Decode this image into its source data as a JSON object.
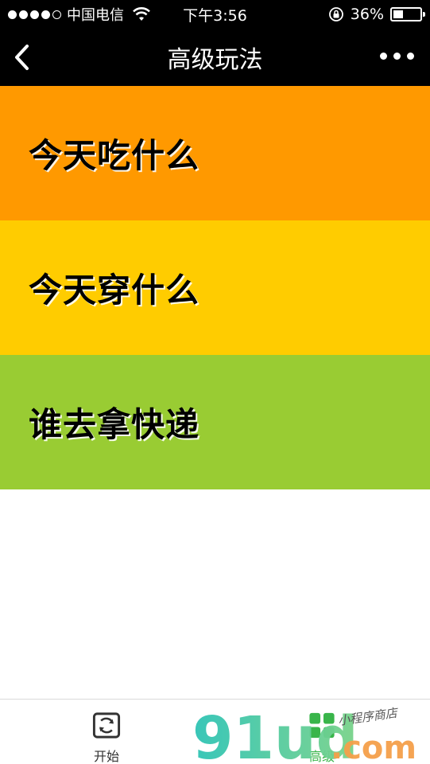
{
  "status_bar": {
    "carrier": "中国电信",
    "time": "下午3:56",
    "battery_percent": "36%",
    "battery_level": 0.36,
    "signal_bars": 4,
    "signal_total": 5,
    "icons": [
      "signal-dots-icon",
      "wifi-icon",
      "rotation-lock-icon",
      "battery-icon"
    ]
  },
  "nav": {
    "title": "高级玩法",
    "back_icon": "chevron-left-icon",
    "more_icon": "more-dots-icon",
    "background": "#000000"
  },
  "items": [
    {
      "label": "今天吃什么",
      "color": "#ff9900"
    },
    {
      "label": "今天穿什么",
      "color": "#ffcc00"
    },
    {
      "label": "谁去拿快递",
      "color": "#99cc33"
    }
  ],
  "tabs": [
    {
      "label": "开始",
      "icon": "refresh-frame-icon",
      "active": false
    },
    {
      "label": "高级",
      "icon": "grid-squares-icon",
      "active": true,
      "color": "#39b54a"
    }
  ],
  "watermark": {
    "brand": "91ud",
    "suffix": ".com",
    "tagline": "小程序商店"
  }
}
